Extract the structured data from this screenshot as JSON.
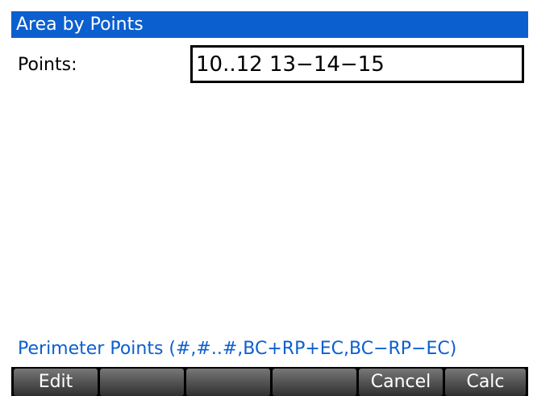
{
  "window": {
    "title": "Area by Points"
  },
  "form": {
    "points_label": "Points:",
    "points_value": "10..12 13−14−15"
  },
  "help": {
    "text": "Perimeter Points (#,#..#,BC+RP+EC,BC−RP−EC)"
  },
  "softkeys": [
    "Edit",
    "",
    "",
    "",
    "Cancel",
    "Calc"
  ],
  "colors": {
    "title_bar": "#0c5fce",
    "help_text": "#0c5fce",
    "softkey_bar": "#000000"
  }
}
